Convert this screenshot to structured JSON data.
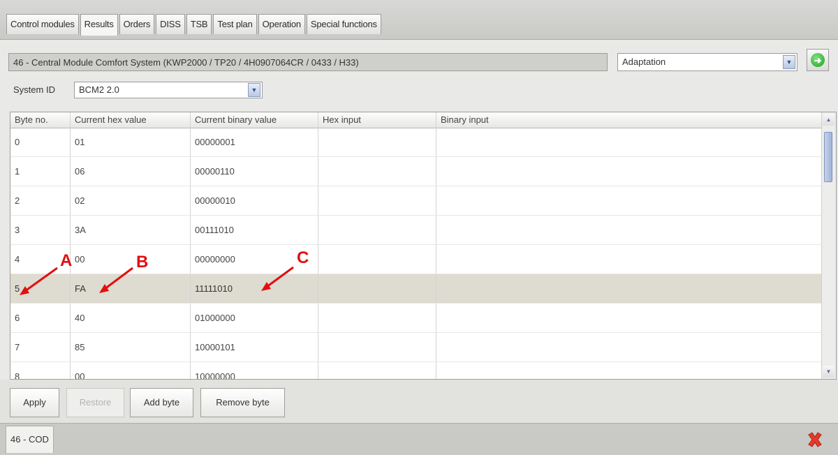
{
  "tabs": [
    {
      "label": "Control modules"
    },
    {
      "label": "Results"
    },
    {
      "label": "Orders"
    },
    {
      "label": "DISS"
    },
    {
      "label": "TSB"
    },
    {
      "label": "Test plan"
    },
    {
      "label": "Operation"
    },
    {
      "label": "Special functions"
    }
  ],
  "active_tab": "Results",
  "module_title": "46 - Central Module Comfort System  (KWP2000 / TP20 / 4H0907064CR / 0433 / H33)",
  "function_select": {
    "value": "Adaptation"
  },
  "system_id": {
    "label": "System ID",
    "value": "BCM2 2.0"
  },
  "grid": {
    "columns": [
      "Byte no.",
      "Current hex value",
      "Current binary value",
      "Hex input",
      "Binary input"
    ],
    "rows": [
      {
        "byte": "0",
        "hex": "01",
        "bin": "00000001"
      },
      {
        "byte": "1",
        "hex": "06",
        "bin": "00000110"
      },
      {
        "byte": "2",
        "hex": "02",
        "bin": "00000010"
      },
      {
        "byte": "3",
        "hex": "3A",
        "bin": "00111010"
      },
      {
        "byte": "4",
        "hex": "00",
        "bin": "00000000"
      },
      {
        "byte": "5",
        "hex": "FA",
        "bin": "11111010"
      },
      {
        "byte": "6",
        "hex": "40",
        "bin": "01000000"
      },
      {
        "byte": "7",
        "hex": "85",
        "bin": "10000101"
      },
      {
        "byte": "8",
        "hex": "00",
        "bin": "10000000"
      }
    ],
    "selected_row": 5
  },
  "annotations": {
    "a": "A",
    "b": "B",
    "c": "C"
  },
  "buttons": {
    "apply": "Apply",
    "restore": "Restore",
    "add_byte": "Add byte",
    "remove_byte": "Remove byte"
  },
  "status_tab": "46 - COD",
  "colors": {
    "annotation": "#e01010",
    "selected_row": "#dedbd0",
    "go_button": "#22a322",
    "close_icon": "#e53b2c"
  }
}
